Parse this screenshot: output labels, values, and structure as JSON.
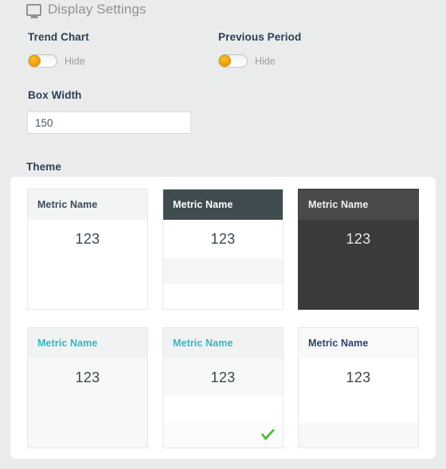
{
  "section": {
    "title": "Display Settings",
    "icon": "monitor-icon"
  },
  "fields": {
    "trend_chart": {
      "label": "Trend Chart",
      "toggle_caption": "Hide",
      "toggle_state": "off"
    },
    "previous_period": {
      "label": "Previous Period",
      "toggle_caption": "Hide",
      "toggle_state": "off"
    },
    "box_width": {
      "label": "Box Width",
      "value": "150",
      "placeholder": "150"
    },
    "theme": {
      "label": "Theme"
    }
  },
  "themes": [
    {
      "id": "theme-1",
      "metric_name": "Metric Name",
      "value": "123",
      "selected": false
    },
    {
      "id": "theme-2",
      "metric_name": "Metric Name",
      "value": "123",
      "selected": false
    },
    {
      "id": "theme-3",
      "metric_name": "Metric Name",
      "value": "123",
      "selected": false
    },
    {
      "id": "theme-4",
      "metric_name": "Metric Name",
      "value": "123",
      "selected": false
    },
    {
      "id": "theme-5",
      "metric_name": "Metric Name",
      "value": "123",
      "selected": true
    },
    {
      "id": "theme-6",
      "metric_name": "Metric Name",
      "value": "123",
      "selected": false
    }
  ],
  "colors": {
    "page_background": "#eaecec",
    "panel_background": "#ffffff",
    "label_text": "#2b3f56",
    "section_title": "#8d9296",
    "toggle_knob": "#f0a00c",
    "accent_teal": "#34b5c4",
    "accent_navy": "#2b3f6b",
    "dark_header": "#3e4c4f",
    "dark_card": "#3b3b3b",
    "check_green": "#55b848"
  }
}
